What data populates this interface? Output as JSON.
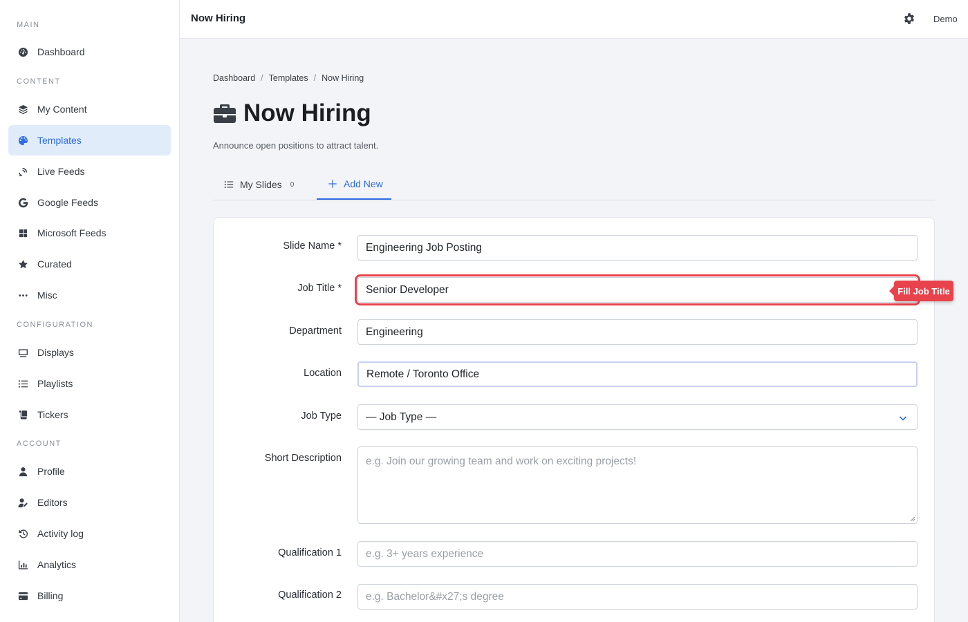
{
  "sidebar": {
    "sections": [
      {
        "title": "MAIN",
        "items": [
          {
            "label": "Dashboard",
            "icon": "dashboard-icon"
          }
        ]
      },
      {
        "title": "CONTENT",
        "items": [
          {
            "label": "My Content",
            "icon": "layers-icon"
          },
          {
            "label": "Templates",
            "icon": "palette-icon",
            "active": true
          },
          {
            "label": "Live Feeds",
            "icon": "satellite-icon"
          },
          {
            "label": "Google Feeds",
            "icon": "google-icon"
          },
          {
            "label": "Microsoft Feeds",
            "icon": "windows-icon"
          },
          {
            "label": "Curated",
            "icon": "star-icon"
          },
          {
            "label": "Misc",
            "icon": "ellipsis-icon"
          }
        ]
      },
      {
        "title": "CONFIGURATION",
        "items": [
          {
            "label": "Displays",
            "icon": "monitor-icon"
          },
          {
            "label": "Playlists",
            "icon": "list-icon"
          },
          {
            "label": "Tickers",
            "icon": "scroll-icon"
          }
        ]
      },
      {
        "title": "ACCOUNT",
        "items": [
          {
            "label": "Profile",
            "icon": "user-icon"
          },
          {
            "label": "Editors",
            "icon": "user-edit-icon"
          },
          {
            "label": "Activity log",
            "icon": "history-icon"
          },
          {
            "label": "Analytics",
            "icon": "chart-icon"
          },
          {
            "label": "Billing",
            "icon": "credit-card-icon"
          }
        ]
      }
    ]
  },
  "topbar": {
    "title": "Now Hiring",
    "user": "Demo",
    "settings_icon": "gear-icon"
  },
  "breadcrumb": [
    "Dashboard",
    "Templates",
    "Now Hiring"
  ],
  "page": {
    "title": "Now Hiring",
    "title_icon": "briefcase-icon",
    "subtitle": "Announce open positions to attract talent."
  },
  "tabs": {
    "my_slides": "My Slides",
    "my_slides_count": "0",
    "add_new": "Add New"
  },
  "form": {
    "slide_name": {
      "label": "Slide Name *",
      "value": "Engineering Job Posting"
    },
    "job_title": {
      "label": "Job Title *",
      "value": "Senior Developer"
    },
    "department": {
      "label": "Department",
      "value": "Engineering"
    },
    "location": {
      "label": "Location",
      "value": "Remote / Toronto Office"
    },
    "job_type": {
      "label": "Job Type",
      "value": "— Job Type —"
    },
    "short_description": {
      "label": "Short Description",
      "placeholder": "e.g. Join our growing team and work on exciting projects!"
    },
    "qualification_1": {
      "label": "Qualification 1",
      "placeholder": "e.g. 3+ years experience"
    },
    "qualification_2": {
      "label": "Qualification 2",
      "placeholder": "e.g. Bachelor&#x27;s degree"
    }
  },
  "tooltip": {
    "text": "Fill Job Title",
    "color": "#e8424c"
  },
  "colors": {
    "accent": "#2d6be4",
    "active_bg": "#e1ecfb"
  }
}
